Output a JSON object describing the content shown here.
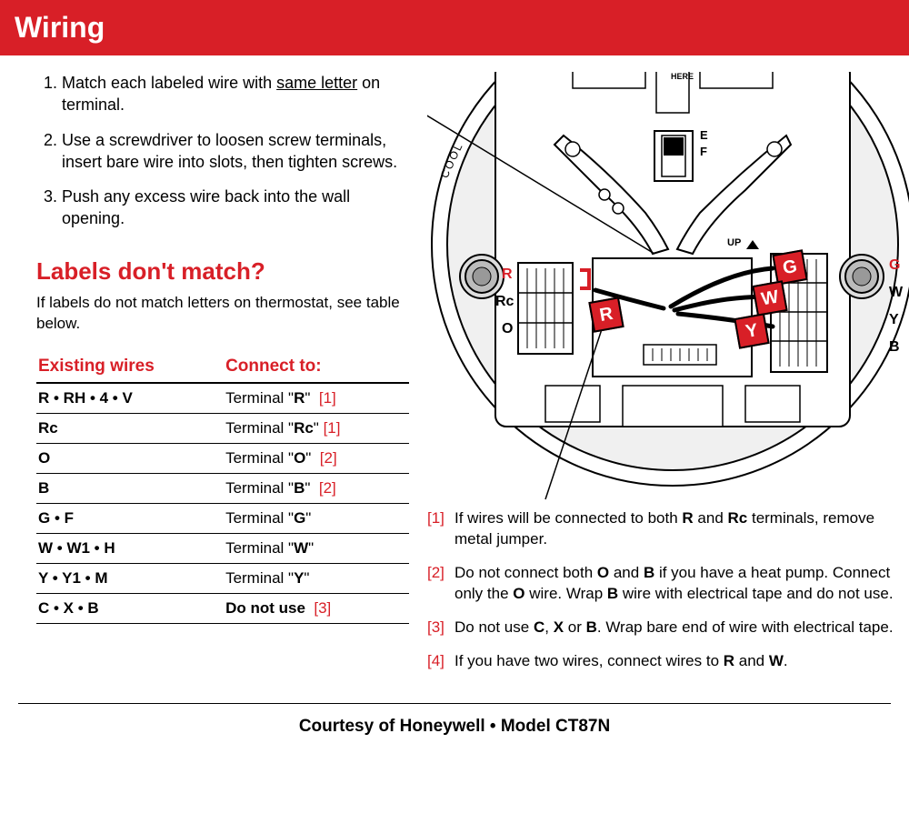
{
  "header": {
    "title": "Wiring"
  },
  "steps": {
    "s1a": "Match each labeled wire with ",
    "s1b": "same letter",
    "s1c": " on terminal.",
    "s2": "Use a screwdriver to loosen screw terminals, insert bare wire into slots, then tighten screws.",
    "s3": "Push any excess wire back into the wall opening."
  },
  "nomatch": {
    "heading": "Labels don't match?",
    "sub": "If labels do not match letters on thermostat, see table below."
  },
  "table": {
    "h1": "Existing wires",
    "h2": "Connect to:",
    "rows": [
      {
        "ex": "R • RH • 4 • V",
        "ta": "Terminal \"",
        "tb": "R",
        "tc": "\"",
        "ref": "[1]"
      },
      {
        "ex": "Rc",
        "ta": "Terminal \"",
        "tb": "Rc",
        "tc": "\"",
        "ref": "[1]"
      },
      {
        "ex": "O",
        "ta": "Terminal \"",
        "tb": "O",
        "tc": "\"",
        "ref": "[2]"
      },
      {
        "ex": "B",
        "ta": "Terminal \"",
        "tb": "B",
        "tc": "\"",
        "ref": "[2]"
      },
      {
        "ex": "G • F",
        "ta": "Terminal \"",
        "tb": "G",
        "tc": "\"",
        "ref": ""
      },
      {
        "ex": "W • W1 • H",
        "ta": "Terminal \"",
        "tb": "W",
        "tc": "\"",
        "ref": ""
      },
      {
        "ex": "Y • Y1 • M",
        "ta": "Terminal \"",
        "tb": "Y",
        "tc": "\"",
        "ref": ""
      },
      {
        "ex": "C • X • B",
        "ta": "",
        "tb": "Do not use",
        "tc": "",
        "ref": "[3]"
      }
    ]
  },
  "diagram": {
    "leftTerms": {
      "R": "R",
      "Rc": "Rc",
      "O": "O"
    },
    "rightTerms": {
      "G": "G",
      "W": "W",
      "Y": "Y",
      "B": "B"
    },
    "smallLbl": {
      "E": "E",
      "F": "F",
      "UP": "UP",
      "HERE": "HERE"
    },
    "side": {
      "cool": "COOL"
    },
    "tags": {
      "R": "R",
      "G": "G",
      "W": "W",
      "Y": "Y"
    }
  },
  "notes": {
    "n1": {
      "num": "[1]",
      "a": "If wires will be connected to both ",
      "b": "R",
      "c": " and ",
      "d": "Rc",
      "e": " terminals, remove metal jumper."
    },
    "n2": {
      "num": "[2]",
      "a": "Do not connect both ",
      "b": "O",
      "c": " and ",
      "d": "B",
      "e": " if you have a heat pump. Connect only the ",
      "f": "O",
      "g": " wire. Wrap ",
      "h": "B",
      "i": " wire with electrical tape and do not use."
    },
    "n3": {
      "num": "[3]",
      "a": "Do not use ",
      "b": "C",
      "c": ", ",
      "d": "X",
      "e": " or ",
      "f": "B",
      "g": ". Wrap bare end of wire with electrical tape."
    },
    "n4": {
      "num": "[4]",
      "a": "If you have two wires, connect wires to ",
      "b": "R",
      "c": " and ",
      "d": "W",
      "e": "."
    }
  },
  "footer": "Courtesy of Honeywell • Model CT87N"
}
